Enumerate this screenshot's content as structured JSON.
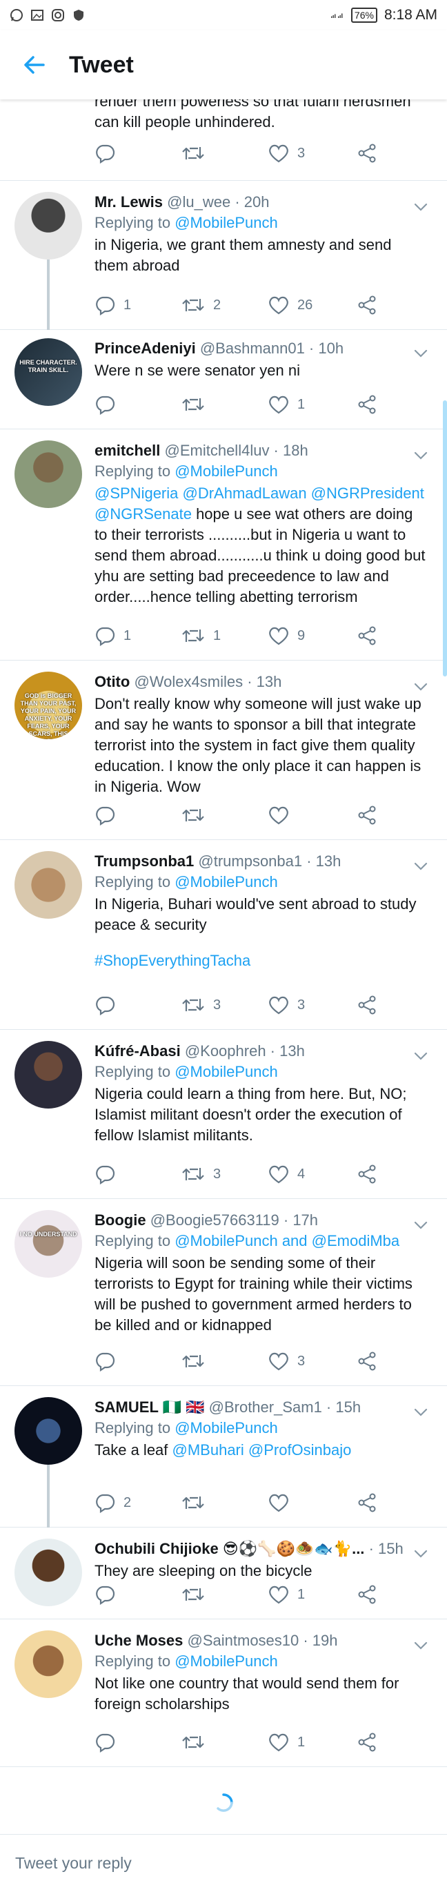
{
  "status_bar": {
    "left_icons": [
      "whatsapp-icon",
      "gallery-icon",
      "instagram-icon",
      "shield-icon"
    ],
    "battery": "76%",
    "time": "8:18 AM"
  },
  "header": {
    "title": "Tweet"
  },
  "top_fragment": {
    "text": "render them powerless so that fulani herdsmen can kill people unhindered.",
    "likes": "3"
  },
  "tweets": [
    {
      "name": "Mr. Lewis",
      "handle": "@lu_wee · 20h",
      "replying_prefix": "Replying to ",
      "replying_to": "@MobilePunch",
      "text": "in Nigeria, we grant them amnesty and send them abroad",
      "replies": "1",
      "retweets": "2",
      "likes": "26"
    },
    {
      "name": "PrinceAdeniyi",
      "handle": "@Bashmann01 · 10h",
      "text": "Were n se were senator yen ni",
      "replies": "",
      "retweets": "",
      "likes": "1",
      "avatar_text": "HIRE CHARACTER. TRAIN SKILL."
    },
    {
      "name": "emitchell",
      "handle": "@Emitchell4luv · 18h",
      "replying_prefix": "Replying to ",
      "replying_to": "@MobilePunch",
      "mentions": "@SPNigeria @DrAhmadLawan @NGRPresident @NGRSenate",
      "text": " hope u see wat others are doing to their terrorists ..........but in Nigeria u want to send them abroad...........u think u doing good but yhu are setting bad preceedence to law and order.....hence telling abetting terrorism",
      "replies": "1",
      "retweets": "1",
      "likes": "9"
    },
    {
      "name": "Otito",
      "handle": "@Wolex4smiles · 13h",
      "text": "Don't really know why someone will just wake up and say he wants to sponsor a bill that integrate terrorist into the system in fact give them quality education. I know the only place it can happen is in Nigeria. Wow",
      "replies": "",
      "retweets": "",
      "likes": "",
      "avatar_text": "GOD is BIGGER THAN YOUR PAST, YOUR PAIN, YOUR ANXIETY, YOUR FEARS, YOUR SCARS, THIS WORLD"
    },
    {
      "name": "Trumpsonba1",
      "handle": "@trumpsonba1 · 13h",
      "replying_prefix": "Replying to ",
      "replying_to": "@MobilePunch",
      "text": "In Nigeria, Buhari would've sent abroad to study peace & security",
      "hashtag": "#ShopEverythingTacha",
      "replies": "",
      "retweets": "3",
      "likes": "3"
    },
    {
      "name": "Kúfré-Abasi",
      "handle": "@Koophreh · 13h",
      "replying_prefix": "Replying to ",
      "replying_to": "@MobilePunch",
      "text": "Nigeria could learn a thing from here. But, NO; Islamist militant doesn't order the execution of fellow Islamist militants.",
      "replies": "",
      "retweets": "3",
      "likes": "4"
    },
    {
      "name": "Boogie",
      "handle": "@Boogie57663119 · 17h",
      "replying_prefix": "Replying to ",
      "replying_to": "@MobilePunch and @EmodiMba",
      "text": "Nigeria will soon be sending some of their terrorists to Egypt for training while their victims will be pushed to government armed herders to be killed and or kidnapped",
      "replies": "",
      "retweets": "",
      "likes": "3",
      "avatar_text": "I NO UNDERSTAND"
    },
    {
      "name": "SAMUEL 🇳🇬 🇬🇧",
      "handle": "@Brother_Sam1 · 15h",
      "replying_prefix": "Replying to ",
      "replying_to": "@MobilePunch",
      "text_prefix": "Take a leaf ",
      "mentions": "@MBuhari @ProfOsinbajo",
      "replies": "2",
      "retweets": "",
      "likes": ""
    },
    {
      "name": "Ochubili Chijioke 😎⚽🦴🍪🧆🐟🐈...",
      "handle": "· 15h",
      "text": "They are sleeping on the bicycle",
      "replies": "",
      "retweets": "",
      "likes": "1"
    },
    {
      "name": "Uche Moses",
      "handle": "@Saintmoses10 · 19h",
      "replying_prefix": "Replying to ",
      "replying_to": "@MobilePunch",
      "text": "Not like one country that would send them for foreign scholarships",
      "replies": "",
      "retweets": "",
      "likes": "1"
    }
  ],
  "reply_bar": {
    "placeholder": "Tweet your reply"
  },
  "colors": {
    "accent": "#1da1f2",
    "secondary_text": "#657786",
    "divider": "#e1e8ed"
  }
}
